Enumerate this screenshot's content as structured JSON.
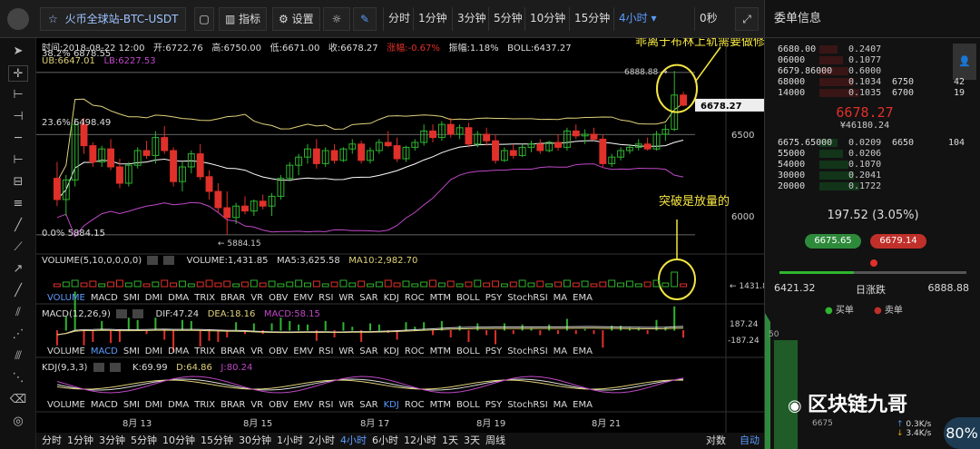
{
  "toolbar": {
    "title": "火币全球站-BTC-USDT",
    "indicators_label": "指标",
    "settings_label": "设置",
    "intervals": [
      "分时",
      "1分钟",
      "3分钟",
      "5分钟",
      "10分钟",
      "15分钟",
      "4小时 ▾"
    ],
    "active_interval": "4小时 ▾",
    "countdown": "0秒"
  },
  "chart_info": {
    "time": "时间:2018-08-22 12:00",
    "open": "开:6722.76",
    "high": "高:6750.00",
    "low": "低:6671.00",
    "close": "收:6678.27",
    "change": "涨幅:-0.67%",
    "amplitude": "振幅:1.18%",
    "boll": "BOLL:6437.27",
    "ub": "UB:6647.01",
    "lb": "LB:6227.53",
    "fib_382": "38.2% 6878.55",
    "fib_236": "23.6% 6498.49",
    "fib_0": "0.0% 5884.15",
    "high_marker": "6888.88 →",
    "low_marker": "← 5884.15",
    "current_price": "6678.27",
    "y_ticks": [
      "6500",
      "6000"
    ]
  },
  "annotations": {
    "top": "乖离于布林上轨需要做修复",
    "bottom": "突破是放量的"
  },
  "volume_pane": {
    "header": "VOLUME(5,10,0,0,0,0)",
    "volume": "VOLUME:1,431.85",
    "ma5": "MA5:3,625.58",
    "ma10": "MA10:2,982.70",
    "last_marker": "← 1431.85",
    "tabs": [
      "VOLUME",
      "MACD",
      "SMI",
      "DMI",
      "DMA",
      "TRIX",
      "BRAR",
      "VR",
      "OBV",
      "EMV",
      "RSI",
      "WR",
      "SAR",
      "KDJ",
      "ROC",
      "MTM",
      "BOLL",
      "PSY",
      "StochRSI",
      "MA",
      "EMA"
    ],
    "active_tab": "VOLUME"
  },
  "macd_pane": {
    "header": "MACD(12,26,9)",
    "dif": "DIF:47.24",
    "dea": "DEA:18.16",
    "macd": "MACD:58.15",
    "y_top": "187.24",
    "y_bottom": "-187.24",
    "tabs": [
      "VOLUME",
      "MACD",
      "SMI",
      "DMI",
      "DMA",
      "TRIX",
      "BRAR",
      "VR",
      "OBV",
      "EMV",
      "RSI",
      "WR",
      "SAR",
      "KDJ",
      "ROC",
      "MTM",
      "BOLL",
      "PSY",
      "StochRSI",
      "MA",
      "EMA"
    ],
    "active_tab": "MACD"
  },
  "kdj_pane": {
    "header": "KDJ(9,3,3)",
    "k": "K:69.99",
    "d": "D:64.86",
    "j": "J:80.24",
    "tabs": [
      "VOLUME",
      "MACD",
      "SMI",
      "DMI",
      "DMA",
      "TRIX",
      "BRAR",
      "VR",
      "OBV",
      "EMV",
      "RSI",
      "WR",
      "SAR",
      "KDJ",
      "ROC",
      "MTM",
      "BOLL",
      "PSY",
      "StochRSI",
      "MA",
      "EMA"
    ],
    "active_tab": "KDJ"
  },
  "x_axis": [
    "8月 13",
    "8月 15",
    "8月 17",
    "8月 19",
    "8月 21"
  ],
  "bottombar": {
    "intervals": [
      "分时",
      "1分钟",
      "3分钟",
      "5分钟",
      "10分钟",
      "15分钟",
      "30分钟",
      "1小时",
      "2小时",
      "4小时",
      "6小时",
      "12小时",
      "1天",
      "3天",
      "周线"
    ],
    "active": "4小时",
    "log_label": "对数",
    "auto_label": "自动"
  },
  "orderbook": {
    "title": "委单信息",
    "asks": [
      {
        "price": "6680.00",
        "amount": "0.2407",
        "price2": "",
        "n": ""
      },
      {
        "price": "06000",
        "amount": "0.1077",
        "price2": "",
        "n": ""
      },
      {
        "price": "6679.86000",
        "amount": "0.6000",
        "price2": "",
        "n": ""
      },
      {
        "price": "68000",
        "amount": "0.1034",
        "price2": "6750",
        "n": "42"
      },
      {
        "price": "14000",
        "amount": "0.1035",
        "price2": "6700",
        "n": "19"
      }
    ],
    "last_price": "6678.27",
    "last_cny": "¥46180.24",
    "bids": [
      {
        "price": "6675.65000",
        "amount": "0.0209",
        "price2": "6650",
        "n": "104"
      },
      {
        "price": "55000",
        "amount": "0.0206",
        "price2": "",
        "n": ""
      },
      {
        "price": "54000",
        "amount": "0.1070",
        "price2": "",
        "n": ""
      },
      {
        "price": "30000",
        "amount": "0.2041",
        "price2": "",
        "n": ""
      },
      {
        "price": "20000",
        "amount": "0.1722",
        "price2": "",
        "n": ""
      }
    ],
    "day_change": "197.52 (3.05%)",
    "buy_price": "6675.65",
    "sell_price": "6679.14",
    "range_low": "6421.32",
    "range_label": "日涨跌",
    "range_high": "6888.88",
    "legend_buy": "买单",
    "legend_sell": "卖单",
    "depth_tick": "6675",
    "depth_tick_side": "50"
  },
  "watermark": {
    "text": "区块链九哥"
  },
  "net_widget": {
    "up": "0.3K/s",
    "down": "3.4K/s",
    "percent": "80%"
  },
  "colors": {
    "up": "#2fb52f",
    "down": "#e0302a",
    "accent": "#5b9cff",
    "annotation": "#f5e642",
    "boll_mid": "#ffffff",
    "boll_band": "#e0d27a",
    "lb_line": "#c048c8"
  },
  "chart_data": {
    "type": "candlestick",
    "x_labels": [
      "8月 13",
      "8月 15",
      "8月 17",
      "8月 19",
      "8月 21"
    ],
    "ylim": [
      5800,
      6950
    ],
    "candles_ohlc": [
      [
        6230,
        6330,
        6060,
        6100
      ],
      [
        6100,
        6250,
        6000,
        6220
      ],
      [
        6220,
        6600,
        6180,
        6560
      ],
      [
        6560,
        6600,
        6380,
        6430
      ],
      [
        6430,
        6450,
        6300,
        6330
      ],
      [
        6330,
        6430,
        6300,
        6410
      ],
      [
        6410,
        6470,
        6280,
        6300
      ],
      [
        6300,
        6350,
        6170,
        6200
      ],
      [
        6200,
        6330,
        6180,
        6310
      ],
      [
        6310,
        6420,
        6290,
        6400
      ],
      [
        6400,
        6460,
        6350,
        6370
      ],
      [
        6370,
        6520,
        6320,
        6480
      ],
      [
        6480,
        6550,
        6380,
        6400
      ],
      [
        6400,
        6420,
        6180,
        6210
      ],
      [
        6210,
        6330,
        6150,
        6300
      ],
      [
        6300,
        6400,
        6260,
        6380
      ],
      [
        6380,
        6440,
        6220,
        6240
      ],
      [
        6240,
        6280,
        6100,
        6150
      ],
      [
        6150,
        6200,
        6020,
        6050
      ],
      [
        6050,
        6150,
        5884,
        5990
      ],
      [
        5990,
        6080,
        5950,
        6060
      ],
      [
        6060,
        6120,
        6010,
        6030
      ],
      [
        6030,
        6100,
        6000,
        6090
      ],
      [
        6090,
        6130,
        6040,
        6060
      ],
      [
        6060,
        6140,
        6000,
        6120
      ],
      [
        6120,
        6250,
        6100,
        6230
      ],
      [
        6230,
        6330,
        6210,
        6310
      ],
      [
        6310,
        6380,
        6250,
        6360
      ],
      [
        6360,
        6440,
        6320,
        6410
      ],
      [
        6410,
        6470,
        6290,
        6320
      ],
      [
        6320,
        6420,
        6300,
        6400
      ],
      [
        6400,
        6440,
        6320,
        6340
      ],
      [
        6340,
        6420,
        6330,
        6410
      ],
      [
        6410,
        6470,
        6380,
        6440
      ],
      [
        6440,
        6460,
        6320,
        6340
      ],
      [
        6340,
        6420,
        6320,
        6400
      ],
      [
        6400,
        6470,
        6380,
        6450
      ],
      [
        6450,
        6520,
        6420,
        6430
      ],
      [
        6430,
        6480,
        6330,
        6350
      ],
      [
        6350,
        6430,
        6330,
        6420
      ],
      [
        6420,
        6470,
        6400,
        6450
      ],
      [
        6450,
        6560,
        6430,
        6520
      ],
      [
        6520,
        6560,
        6450,
        6480
      ],
      [
        6480,
        6580,
        6460,
        6560
      ],
      [
        6560,
        6600,
        6480,
        6500
      ],
      [
        6500,
        6560,
        6470,
        6540
      ],
      [
        6540,
        6570,
        6420,
        6440
      ],
      [
        6440,
        6520,
        6420,
        6500
      ],
      [
        6500,
        6540,
        6430,
        6460
      ],
      [
        6460,
        6500,
        6320,
        6340
      ],
      [
        6340,
        6420,
        6330,
        6400
      ],
      [
        6400,
        6440,
        6350,
        6370
      ],
      [
        6370,
        6440,
        6360,
        6420
      ],
      [
        6420,
        6460,
        6390,
        6440
      ],
      [
        6440,
        6470,
        6380,
        6400
      ],
      [
        6400,
        6460,
        6390,
        6450
      ],
      [
        6450,
        6500,
        6400,
        6420
      ],
      [
        6420,
        6540,
        6400,
        6520
      ],
      [
        6520,
        6560,
        6470,
        6490
      ],
      [
        6490,
        6530,
        6440,
        6500
      ],
      [
        6500,
        6540,
        6460,
        6470
      ],
      [
        6470,
        6500,
        6300,
        6320
      ],
      [
        6320,
        6380,
        6300,
        6360
      ],
      [
        6360,
        6420,
        6340,
        6400
      ],
      [
        6400,
        6440,
        6380,
        6420
      ],
      [
        6420,
        6470,
        6400,
        6440
      ],
      [
        6440,
        6480,
        6400,
        6410
      ],
      [
        6410,
        6520,
        6400,
        6500
      ],
      [
        6500,
        6560,
        6460,
        6530
      ],
      [
        6530,
        6888,
        6520,
        6740
      ],
      [
        6740,
        6760,
        6671,
        6678
      ]
    ]
  }
}
